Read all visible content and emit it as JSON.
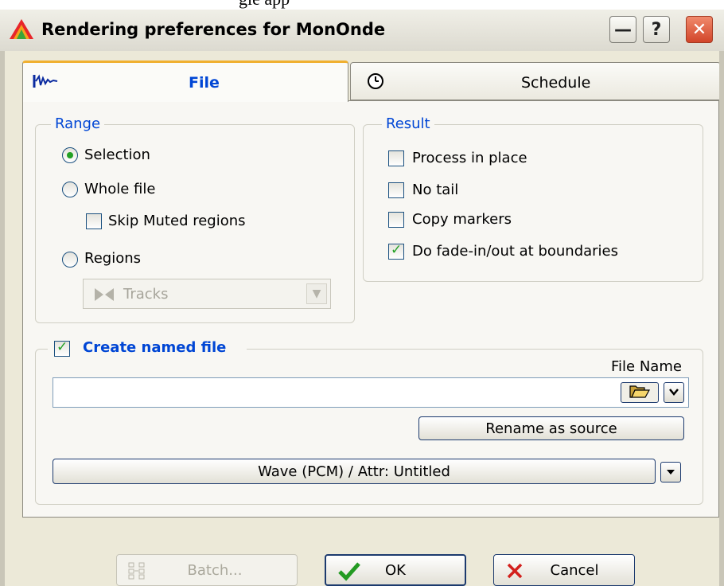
{
  "top_caption": "gle app",
  "window": {
    "title": "Rendering preferences for MonOnde",
    "minimize_label": "—",
    "help_label": "?",
    "close_label": "✕"
  },
  "tabs": [
    {
      "label": "File",
      "icon": "waveform-icon",
      "selected": true
    },
    {
      "label": "Schedule",
      "icon": "clock-icon",
      "selected": false
    }
  ],
  "range": {
    "legend": "Range",
    "selection_label": "Selection",
    "whole_file_label": "Whole file",
    "skip_muted_label": "Skip Muted regions",
    "regions_label": "Regions",
    "regions_combo_value": "Tracks",
    "selected": "Selection",
    "skip_muted_checked": false
  },
  "result": {
    "legend": "Result",
    "process_in_place_label": "Process in place",
    "no_tail_label": "No tail",
    "copy_markers_label": "Copy markers",
    "fade_label": "Do fade-in/out at boundaries",
    "process_in_place_checked": false,
    "no_tail_checked": false,
    "copy_markers_checked": false,
    "fade_checked": true
  },
  "named_file": {
    "legend": "Create named file",
    "checked": true,
    "file_name_label": "File Name",
    "file_name_value": "",
    "rename_button": "Rename as source",
    "format_button": "Wave (PCM) / Attr: Untitled"
  },
  "footer": {
    "batch_label": "Batch...",
    "ok_label": "OK",
    "cancel_label": "Cancel"
  },
  "colors": {
    "legend_blue": "#0046d5",
    "check_green": "#22a024",
    "dialog_bg": "#ece9d8",
    "tab_highlight": "#f0b030"
  }
}
